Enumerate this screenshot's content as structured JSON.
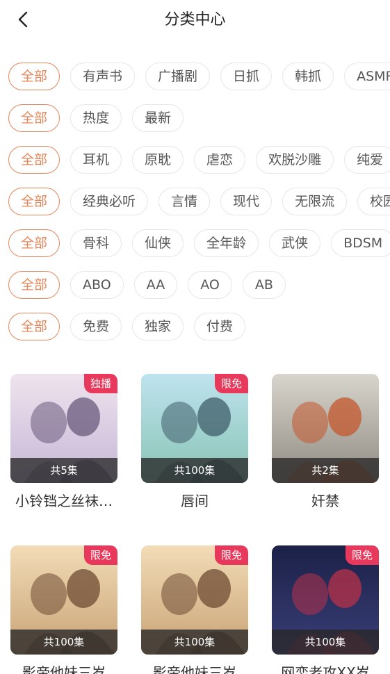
{
  "header": {
    "title": "分类中心",
    "back_icon": "chevron-left-icon"
  },
  "filter_rows": [
    {
      "id": "type",
      "chips": [
        "全部",
        "有声书",
        "广播剧",
        "日抓",
        "韩抓",
        "ASMR"
      ],
      "active": 0
    },
    {
      "id": "sort",
      "chips": [
        "全部",
        "热度",
        "最新"
      ],
      "active": 0
    },
    {
      "id": "tag",
      "chips": [
        "全部",
        "耳机",
        "原耽",
        "虐恋",
        "欢脱沙雕",
        "纯爱"
      ],
      "active": 0
    },
    {
      "id": "genre",
      "chips": [
        "全部",
        "经典必听",
        "言情",
        "现代",
        "无限流",
        "校园"
      ],
      "active": 0
    },
    {
      "id": "theme",
      "chips": [
        "全部",
        "骨科",
        "仙侠",
        "全年龄",
        "武侠",
        "BDSM"
      ],
      "active": 0
    },
    {
      "id": "pairing",
      "chips": [
        "全部",
        "ABO",
        "AA",
        "AO",
        "AB"
      ],
      "active": 0
    },
    {
      "id": "price",
      "chips": [
        "全部",
        "免费",
        "独家",
        "付费"
      ],
      "active": 0
    }
  ],
  "cards": [
    {
      "title": "小铃铛之丝袜…",
      "badge": "独播",
      "episodes": "共5集",
      "palette": [
        "#efe3ee",
        "#c6b7d6",
        "#6a5a7c"
      ]
    },
    {
      "title": "唇间",
      "badge": "限免",
      "episodes": "共100集",
      "palette": [
        "#bfe3ef",
        "#87c3b3",
        "#3f5d6a"
      ]
    },
    {
      "title": "奸禁",
      "badge": "",
      "episodes": "共2集",
      "palette": [
        "#d8d5cd",
        "#8f8a80",
        "#c4572c"
      ]
    },
    {
      "title": "影帝他妹三岁",
      "badge": "限免",
      "episodes": "共100集",
      "palette": [
        "#f2dcb6",
        "#c8a276",
        "#6d4b33"
      ]
    },
    {
      "title": "影帝他妹三岁",
      "badge": "限免",
      "episodes": "共100集",
      "palette": [
        "#f2dcb6",
        "#c8a276",
        "#6d4b33"
      ]
    },
    {
      "title": "网恋老攻XX岁",
      "badge": "限免",
      "episodes": "共100集",
      "palette": [
        "#1b2147",
        "#3a3f78",
        "#b8324a"
      ]
    }
  ],
  "colors": {
    "accent": "#e4865a",
    "badge": "#e8385b",
    "chip_border": "#e6e6e6"
  }
}
